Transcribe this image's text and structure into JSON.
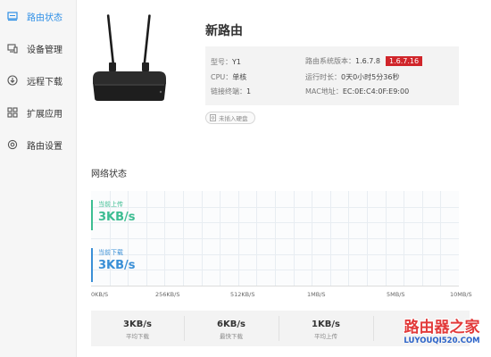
{
  "sidebar": {
    "items": [
      {
        "label": "路由状态",
        "icon": "router-status-icon",
        "active": true
      },
      {
        "label": "设备管理",
        "icon": "device-icon",
        "active": false
      },
      {
        "label": "远程下载",
        "icon": "download-icon",
        "active": false
      },
      {
        "label": "扩展应用",
        "icon": "apps-grid-icon",
        "active": false
      },
      {
        "label": "路由设置",
        "icon": "gear-icon",
        "active": false
      }
    ]
  },
  "router": {
    "name": "新路由",
    "model_label": "型号：",
    "model_value": "Y1",
    "cpu_label": "CPU：",
    "cpu_value": "单核",
    "ports_label": "链接终端：",
    "ports_value": "1",
    "fw_label": "路由系统版本：",
    "fw_value": "1.6.7.8",
    "fw_new": "1.6.7.16",
    "uptime_label": "运行时长：",
    "uptime_value": "0天0小时5分36秒",
    "mac_label": "MAC地址：",
    "mac_value": "EC:0E:C4:0F:E9:00",
    "disk_tag": "未插入硬盘"
  },
  "network": {
    "title": "网络状态",
    "upload_label": "当前上传",
    "upload_value": "3KB/s",
    "download_label": "当前下载",
    "download_value": "3KB/s"
  },
  "chart_data": {
    "type": "bar",
    "categories": [
      "当前上传",
      "当前下载"
    ],
    "values": [
      "3KB/s",
      "3KB/s"
    ],
    "x_ticks": [
      "0KB/S",
      "256KB/S",
      "512KB/S",
      "1MB/S",
      "5MB/S",
      "10MB/S"
    ],
    "grid": true
  },
  "stats": [
    {
      "value": "3KB/s",
      "label": "平均下载"
    },
    {
      "value": "6KB/s",
      "label": "最快下载"
    },
    {
      "value": "1KB/s",
      "label": "平均上传"
    }
  ],
  "watermark": {
    "text": "路由器之家",
    "url": "LUYOUQI520.COM"
  },
  "colors": {
    "accent": "#2e8fe6",
    "upload": "#3dbd92",
    "download": "#3a8fd6",
    "badge": "#d0252a"
  }
}
